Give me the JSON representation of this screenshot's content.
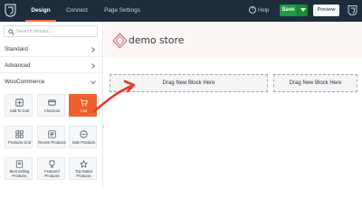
{
  "topbar": {
    "tabs": [
      {
        "label": "Design",
        "active": true
      },
      {
        "label": "Connect",
        "active": false
      },
      {
        "label": "Page Settings",
        "active": false
      }
    ],
    "help_label": "Help",
    "save_label": "Save",
    "preview_label": "Preview",
    "colors": {
      "bar": "#1d2d3c",
      "save": "#1f9c42",
      "accent": "#ff6b3d"
    }
  },
  "sidebar": {
    "search_placeholder": "Search blocks...",
    "sections": [
      {
        "label": "Standard",
        "chevron": "chevron-right-icon"
      },
      {
        "label": "Advanced",
        "chevron": "chevron-right-icon"
      },
      {
        "label": "WooCommerce",
        "chevron": "chevron-down-icon"
      }
    ],
    "blocks": [
      {
        "label": "Add To Cart",
        "icon": "cart-add-icon",
        "active": false
      },
      {
        "label": "Checkout",
        "icon": "checkout-icon",
        "active": false
      },
      {
        "label": "Cart",
        "icon": "cart-icon",
        "active": true
      },
      {
        "label": "Products Grid",
        "icon": "products-grid-icon",
        "active": false
      },
      {
        "label": "Recent Products",
        "icon": "recent-products-icon",
        "active": false
      },
      {
        "label": "Sale Products",
        "icon": "sale-products-icon",
        "active": false
      },
      {
        "label": "Best Selling Products",
        "icon": "best-selling-icon",
        "active": false
      },
      {
        "label": "Featured Products",
        "icon": "featured-products-icon",
        "active": false
      },
      {
        "label": "Top Rated Products",
        "icon": "top-rated-icon",
        "active": false
      }
    ],
    "active_color": "#ef5f2b"
  },
  "canvas": {
    "brand_name": "demo store",
    "dropzones": [
      {
        "label": "Drag New Block Here"
      },
      {
        "label": "Drag New Block Here"
      }
    ],
    "arrow_color": "#e8372c"
  }
}
